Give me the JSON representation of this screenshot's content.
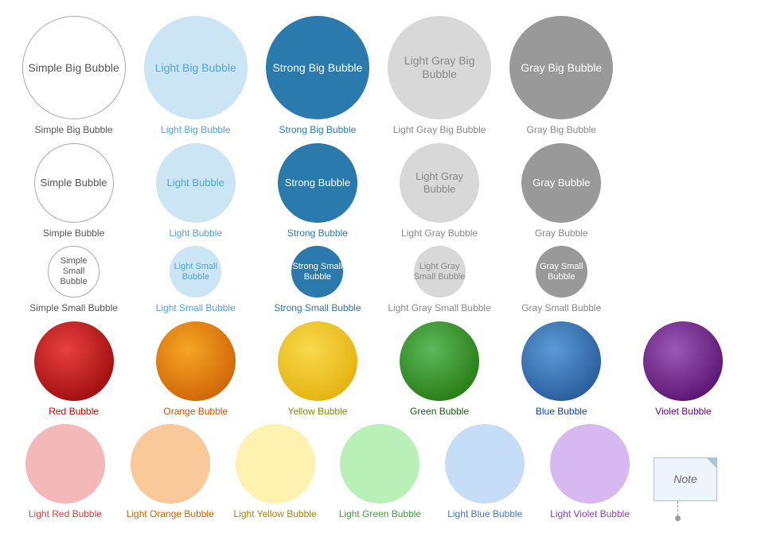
{
  "bubbles": {
    "rows": [
      [
        {
          "id": "simple-big",
          "label": "Simple Big Bubble",
          "size": "big",
          "style": "simple",
          "labelColor": ""
        },
        {
          "id": "light-big",
          "label": "Light Big Bubble",
          "size": "big",
          "style": "light-blue-bubble",
          "labelColor": "#4da6d9"
        },
        {
          "id": "strong-big",
          "label": "Strong Big Bubble",
          "size": "big",
          "style": "strong-blue",
          "labelColor": "#fff"
        },
        {
          "id": "light-gray-big",
          "label": "Light Gray Big Bubble",
          "size": "big",
          "style": "light-gray",
          "labelColor": "#888"
        },
        {
          "id": "gray-big",
          "label": "Gray Big Bubble",
          "size": "big",
          "style": "gray",
          "labelColor": "#fff"
        }
      ],
      [
        {
          "id": "simple",
          "label": "Simple Bubble",
          "size": "medium",
          "style": "simple",
          "labelColor": ""
        },
        {
          "id": "light",
          "label": "Light Bubble",
          "size": "medium",
          "style": "light-blue-bubble",
          "labelColor": "#4da6d9"
        },
        {
          "id": "strong",
          "label": "Strong Bubble",
          "size": "medium",
          "style": "strong-blue",
          "labelColor": "#fff"
        },
        {
          "id": "light-gray",
          "label": "Light Gray Bubble",
          "size": "medium",
          "style": "light-gray",
          "labelColor": "#888"
        },
        {
          "id": "gray",
          "label": "Gray Bubble",
          "size": "medium",
          "style": "gray",
          "labelColor": "#fff"
        }
      ],
      [
        {
          "id": "simple-small",
          "label": "Simple Small Bubble",
          "size": "small",
          "style": "simple",
          "labelColor": ""
        },
        {
          "id": "light-small",
          "label": "Light Small Bubble",
          "size": "small",
          "style": "light-blue-bubble",
          "labelColor": "#4da6d9"
        },
        {
          "id": "strong-small",
          "label": "Strong Small Bubble",
          "size": "small",
          "style": "strong-blue",
          "labelColor": "#fff"
        },
        {
          "id": "light-gray-small",
          "label": "Light Gray Small Bubble",
          "size": "small",
          "style": "light-gray",
          "labelColor": "#888"
        },
        {
          "id": "gray-small",
          "label": "Gray Small Bubble",
          "size": "small",
          "style": "gray",
          "labelColor": "#fff"
        }
      ],
      [
        {
          "id": "red",
          "label": "Red Bubble",
          "size": "medium",
          "style": "red",
          "labelColor": "#cc0000"
        },
        {
          "id": "orange",
          "label": "Orange Bubble",
          "size": "medium",
          "style": "orange",
          "labelColor": "#cc5500"
        },
        {
          "id": "yellow",
          "label": "Yellow Bubble",
          "size": "medium",
          "style": "yellow",
          "labelColor": "#888800"
        },
        {
          "id": "green",
          "label": "Green Bubble",
          "size": "medium",
          "style": "green",
          "labelColor": "#116611"
        },
        {
          "id": "blue",
          "label": "Blue Bubble",
          "size": "medium",
          "style": "blue",
          "labelColor": "#1144aa"
        },
        {
          "id": "violet",
          "label": "Violet Bubble",
          "size": "medium",
          "style": "violet",
          "labelColor": "#660088"
        }
      ],
      [
        {
          "id": "light-red",
          "label": "Light Red Bubble",
          "size": "medium",
          "style": "light-red",
          "labelColor": "#cc4444"
        },
        {
          "id": "light-orange",
          "label": "Light Orange Bubble",
          "size": "medium",
          "style": "light-orange",
          "labelColor": "#cc6600"
        },
        {
          "id": "light-yellow",
          "label": "Light Yellow Bubble",
          "size": "medium",
          "style": "light-yellow",
          "labelColor": "#998800"
        },
        {
          "id": "light-green",
          "label": "Light Green Bubble",
          "size": "medium",
          "style": "light-green",
          "labelColor": "#449944"
        },
        {
          "id": "light-blue",
          "label": "Light Blue Bubble",
          "size": "medium",
          "style": "light-blue",
          "labelColor": "#4477cc"
        },
        {
          "id": "light-violet",
          "label": "Light Violet Bubble",
          "size": "medium",
          "style": "light-violet",
          "labelColor": "#8844bb"
        }
      ]
    ],
    "note": {
      "label": "Note"
    }
  }
}
